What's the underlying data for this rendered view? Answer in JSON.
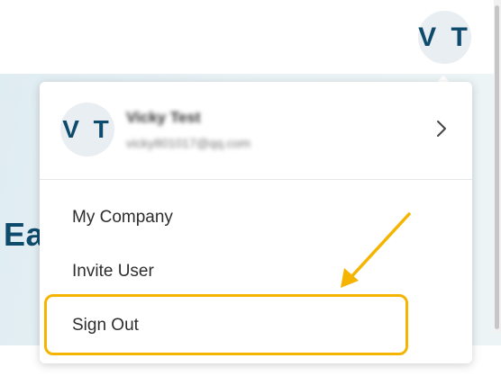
{
  "header": {
    "avatar_initials": "V T"
  },
  "hero": {
    "title_fragment": "Ea"
  },
  "account_menu": {
    "user": {
      "initials": "V T",
      "name": "Vicky Test",
      "email": "vicky801017@qq.com"
    },
    "items": [
      {
        "label": "My Company"
      },
      {
        "label": "Invite User"
      },
      {
        "label": "Sign Out"
      }
    ]
  },
  "annotation": {
    "highlight_color": "#f5b400",
    "highlighted_item": "Sign Out"
  },
  "colors": {
    "brand": "#0d4a6b",
    "avatar_bg": "#e8eef1",
    "hero_bg": "#e6f0f4"
  }
}
